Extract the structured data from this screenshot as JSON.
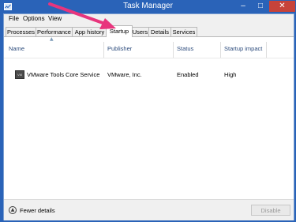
{
  "window": {
    "title": "Task Manager"
  },
  "controls": {
    "minimize": "–",
    "maximize": "□",
    "close": "✕"
  },
  "menu": [
    "File",
    "Options",
    "View"
  ],
  "tabs": [
    "Processes",
    "Performance",
    "App history",
    "Startup",
    "Users",
    "Details",
    "Services"
  ],
  "active_tab": "Startup",
  "columns": {
    "name": "Name",
    "publisher": "Publisher",
    "status": "Status",
    "impact": "Startup impact"
  },
  "rows": [
    {
      "icon": "vmware-icon",
      "icon_text": "VM",
      "name": "VMware Tools Core Service",
      "publisher": "VMware, Inc.",
      "status": "Enabled",
      "impact": "High"
    }
  ],
  "footer": {
    "fewer_details": "Fewer details",
    "disable": "Disable"
  },
  "colors": {
    "titlebar": "#2a63b8",
    "close": "#c7433a",
    "annotation_arrow": "#e8357d"
  }
}
